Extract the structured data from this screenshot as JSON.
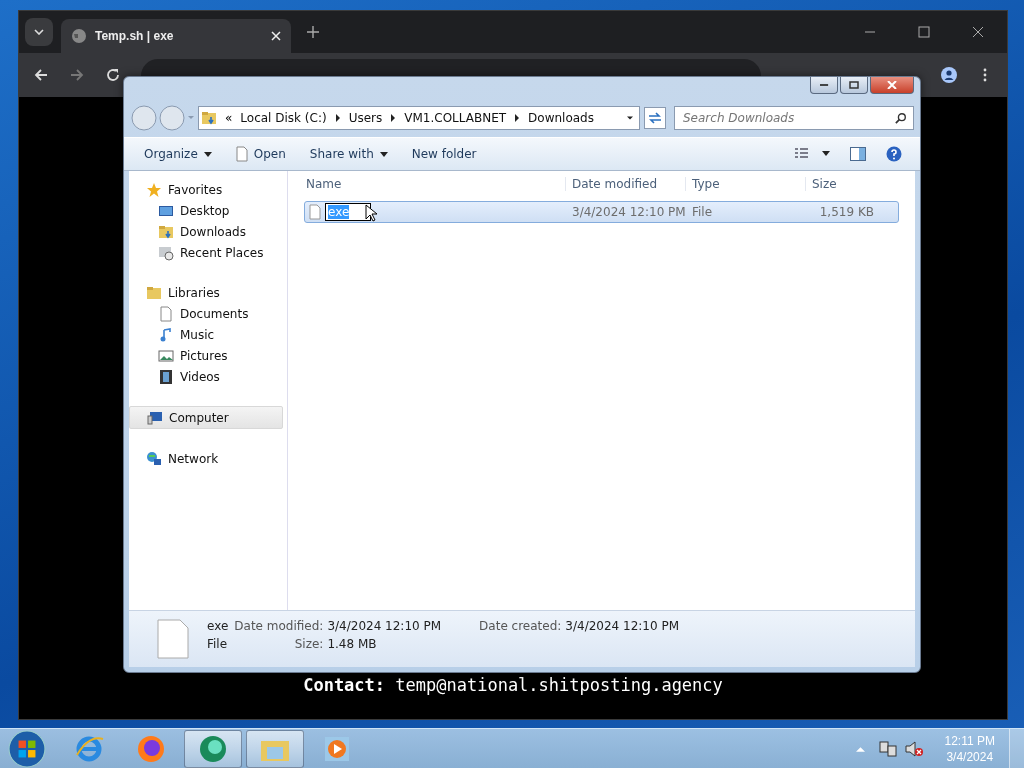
{
  "browser": {
    "tab": {
      "title": "Temp.sh | exe"
    },
    "contact": {
      "label": "Contact:",
      "email": "temp@national.shitposting.agency"
    }
  },
  "explorer": {
    "overflow": "«",
    "breadcrumb": [
      "Local Disk (C:)",
      "Users",
      "VM1.COLLABNET",
      "Downloads"
    ],
    "search": {
      "placeholder": "Search Downloads"
    },
    "toolbar": [
      {
        "label": "Organize",
        "kind": "menu"
      },
      {
        "label": "Open",
        "kind": "open"
      },
      {
        "label": "Share with",
        "kind": "menu"
      },
      {
        "label": "New folder",
        "kind": "plain"
      }
    ],
    "nav": [
      {
        "label": "Favorites",
        "selected": false,
        "children": [
          {
            "label": "Desktop",
            "selected": false
          },
          {
            "label": "Downloads",
            "selected": false
          },
          {
            "label": "Recent Places",
            "selected": false
          }
        ]
      },
      {
        "label": "Libraries",
        "selected": false,
        "children": [
          {
            "label": "Documents",
            "selected": false
          },
          {
            "label": "Music",
            "selected": false
          },
          {
            "label": "Pictures",
            "selected": false
          },
          {
            "label": "Videos",
            "selected": false
          }
        ]
      },
      {
        "label": "Computer",
        "selected": true
      },
      {
        "label": "Network",
        "selected": false
      }
    ],
    "columns": [
      "Name",
      "Date modified",
      "Type",
      "Size"
    ],
    "files": [
      {
        "name": "exe",
        "date": "3/4/2024 12:10 PM",
        "type": "File",
        "size": "1,519 KB",
        "selected": true,
        "renaming": true
      }
    ],
    "details": {
      "name": "exe",
      "type": "File",
      "modified_label": "Date modified:",
      "modified": "3/4/2024 12:10 PM",
      "size_label": "Size:",
      "size": "1.48 MB",
      "created_label": "Date created:",
      "created": "3/4/2024 12:10 PM"
    }
  },
  "taskbar": {
    "apps": [
      {
        "active": false
      },
      {
        "active": false
      },
      {
        "active": true
      },
      {
        "active": true
      },
      {
        "active": false
      }
    ],
    "time": "12:11 PM",
    "date": "3/4/2024"
  }
}
